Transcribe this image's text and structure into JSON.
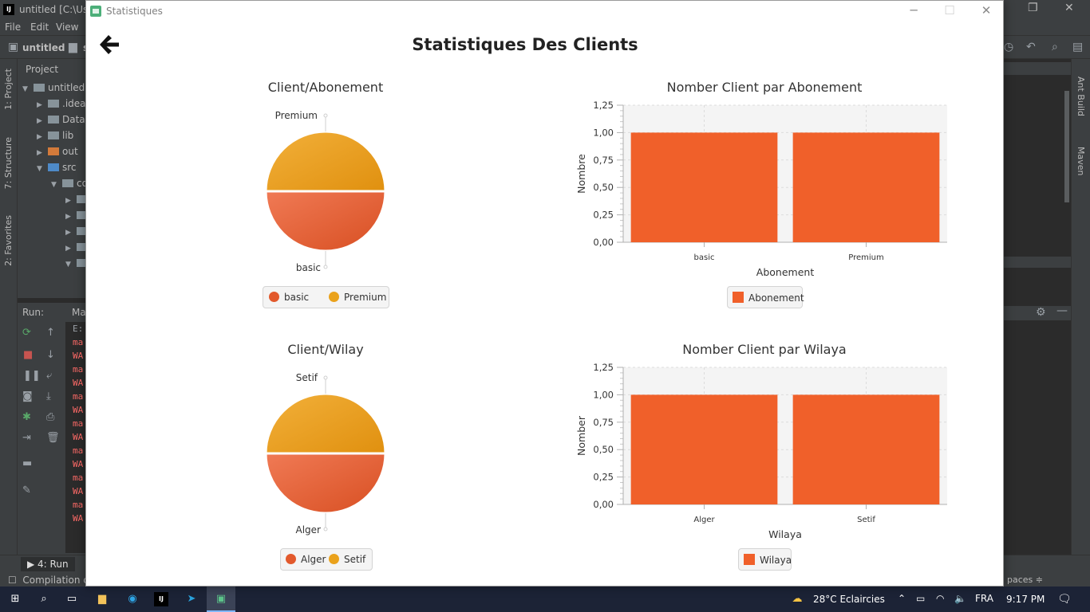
{
  "ide": {
    "window_title": "untitled [C:\\Use",
    "menu": [
      "File",
      "Edit",
      "View"
    ],
    "breadcrumb_root": "untitled",
    "breadcrumb_next": "s",
    "project_header": "Project",
    "tree": [
      {
        "label": "untitled [",
        "indent": 0,
        "arrow": "▼",
        "color": "gray"
      },
      {
        "label": ".idea",
        "indent": 1,
        "arrow": "▶",
        "color": "gray"
      },
      {
        "label": "Datab",
        "indent": 1,
        "arrow": "▶",
        "color": "gray"
      },
      {
        "label": "lib",
        "indent": 1,
        "arrow": "▶",
        "color": "gray"
      },
      {
        "label": "out",
        "indent": 1,
        "arrow": "▶",
        "color": "orange"
      },
      {
        "label": "src",
        "indent": 1,
        "arrow": "▼",
        "color": "blue"
      },
      {
        "label": "co",
        "indent": 2,
        "arrow": "▼",
        "color": "gray"
      },
      {
        "label": "",
        "indent": 3,
        "arrow": "▶",
        "color": "gray"
      },
      {
        "label": "",
        "indent": 3,
        "arrow": "▶",
        "color": "gray"
      },
      {
        "label": "",
        "indent": 3,
        "arrow": "▶",
        "color": "gray"
      },
      {
        "label": "",
        "indent": 3,
        "arrow": "▶",
        "color": "gray"
      },
      {
        "label": "",
        "indent": 3,
        "arrow": "▼",
        "color": "gray"
      }
    ],
    "left_tabs": [
      "1: Project",
      "7: Structure",
      "2: Favorites"
    ],
    "right_tabs": [
      "Ant Build",
      "Maven"
    ],
    "run_label": "Run:",
    "run_config": "Ma",
    "console_lines": [
      "E:",
      "ma",
      "WA",
      "ma",
      "WA",
      "ma",
      "WA",
      "ma",
      "WA",
      "ma",
      "WA",
      "ma",
      "WA",
      "ma",
      "WA"
    ],
    "run_tab": "4: Run",
    "status_text": "Compilation c",
    "status_right": "paces ≑"
  },
  "taskbar": {
    "weather": "28°C  Eclaircies",
    "language": "FRA",
    "time": "9:17 PM"
  },
  "dialog": {
    "title": "Statistiques",
    "page_title": "Statistiques Des Clients"
  },
  "charts": {
    "pie_abonement": {
      "title": "Client/Abonement",
      "slice_top_label": "Premium",
      "slice_bottom_label": "basic",
      "legend": [
        {
          "label": "basic",
          "color": "#e2592c"
        },
        {
          "label": "Premium",
          "color": "#eaa21c"
        }
      ]
    },
    "pie_wilaya": {
      "title": "Client/Wilay",
      "slice_top_label": "Setif",
      "slice_bottom_label": "Alger",
      "legend": [
        {
          "label": "Alger",
          "color": "#e2592c"
        },
        {
          "label": "Setif",
          "color": "#eaa21c"
        }
      ]
    },
    "bar_abonement": {
      "title": "Nomber Client par Abonement",
      "xlabel": "Abonement",
      "ylabel": "Nombre",
      "legend": "Abonement"
    },
    "bar_wilaya": {
      "title": "Nomber Client par Wilaya",
      "xlabel": "Wilaya",
      "ylabel": "Nomber",
      "legend": "Wilaya"
    }
  },
  "chart_data": [
    {
      "type": "pie",
      "title": "Client/Abonement",
      "categories": [
        "basic",
        "Premium"
      ],
      "values": [
        1,
        1
      ],
      "colors": [
        "#e2592c",
        "#eaa21c"
      ]
    },
    {
      "type": "bar",
      "title": "Nomber Client par Abonement",
      "categories": [
        "basic",
        "Premium"
      ],
      "series": [
        {
          "name": "Abonement",
          "values": [
            1,
            1
          ]
        }
      ],
      "xlabel": "Abonement",
      "ylabel": "Nombre",
      "ylim": [
        0,
        1.25
      ],
      "yticks": [
        "0,00",
        "0,25",
        "0,50",
        "0,75",
        "1,00",
        "1,25"
      ],
      "color": "#f0602a",
      "grid": true,
      "legend_position": "bottom"
    },
    {
      "type": "pie",
      "title": "Client/Wilay",
      "categories": [
        "Alger",
        "Setif"
      ],
      "values": [
        1,
        1
      ],
      "colors": [
        "#e2592c",
        "#eaa21c"
      ]
    },
    {
      "type": "bar",
      "title": "Nomber Client par Wilaya",
      "categories": [
        "Alger",
        "Setif"
      ],
      "series": [
        {
          "name": "Wilaya",
          "values": [
            1,
            1
          ]
        }
      ],
      "xlabel": "Wilaya",
      "ylabel": "Nomber",
      "ylim": [
        0,
        1.25
      ],
      "yticks": [
        "0,00",
        "0,25",
        "0,50",
        "0,75",
        "1,00",
        "1,25"
      ],
      "color": "#f0602a",
      "grid": true,
      "legend_position": "bottom"
    }
  ]
}
